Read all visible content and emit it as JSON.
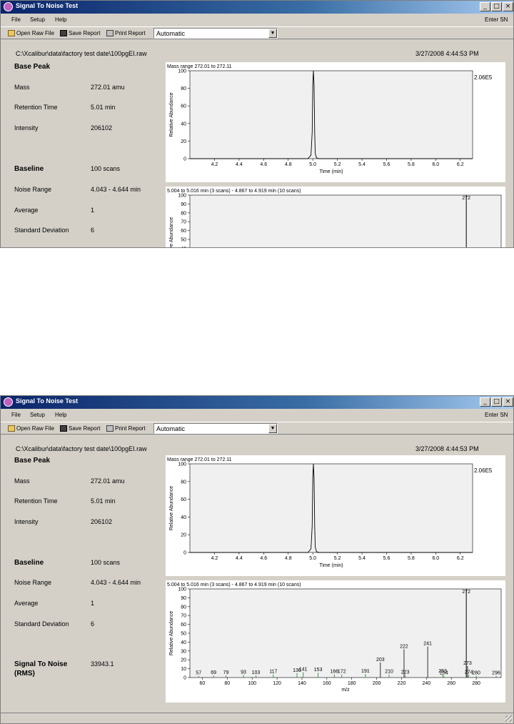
{
  "window": {
    "title": "Signal To Noise Test",
    "minimize_glyph": "_",
    "maximize_glyph": "□",
    "close_glyph": "×"
  },
  "menu": {
    "file": "File",
    "setup": "Setup",
    "help": "Help",
    "enter_sn": "Enter SN"
  },
  "toolbar": {
    "open_raw_file": "Open Raw File",
    "save_report": "Save Report",
    "print_report": "Print Report",
    "mode_select": "Automatic"
  },
  "file_path": "C:\\Xcalibur\\data\\factory test date\\100pgEI.raw",
  "datetime": "3/27/2008 4:44:53 PM",
  "stats": {
    "base_peak": "Base Peak",
    "mass_label": "Mass",
    "mass_value": "272.01 amu",
    "rt_label": "Retention Time",
    "rt_value": "5.01 min",
    "intensity_label": "Intensity",
    "intensity_value": "206102",
    "baseline_label": "Baseline",
    "baseline_value": "100 scans",
    "noise_range_label": "Noise Range",
    "noise_range_value": "4.043 - 4.644 min",
    "average_label": "Average",
    "average_value": "1",
    "std_dev_label": "Standard Deviation",
    "std_dev_value": "6",
    "sn_label_1": "Signal To Noise",
    "sn_label_2": "(RMS)",
    "sn_value": "33943.1"
  },
  "chart_data": [
    {
      "type": "line",
      "title": "Mass range 272.01 to 272.11",
      "xlabel": "Time (min)",
      "ylabel": "Relative Abundance",
      "annotation": "2.06E5",
      "xlim": [
        4.0,
        6.3
      ],
      "ylim": [
        0,
        100
      ],
      "xticks": [
        4.2,
        4.4,
        4.6,
        4.8,
        5.0,
        5.2,
        5.4,
        5.6,
        5.8,
        6.0,
        6.2
      ],
      "yticks": [
        0,
        20,
        40,
        60,
        80,
        100
      ],
      "x": [
        4.0,
        4.96,
        4.985,
        4.995,
        5.0,
        5.005,
        5.01,
        5.015,
        5.02,
        5.03,
        5.05,
        6.3
      ],
      "y": [
        0,
        0,
        4,
        30,
        85,
        100,
        85,
        30,
        6,
        1,
        0,
        0
      ]
    },
    {
      "type": "bar",
      "title": "5.004 to 5.016 min (3 scans) - 4.867 to 4.919 min (10 scans)",
      "xlabel": "m/z",
      "ylabel": "Relative Abundance",
      "xlim": [
        50,
        300
      ],
      "ylim": [
        0,
        100
      ],
      "xticks": [
        60,
        80,
        100,
        120,
        140,
        160,
        180,
        200,
        220,
        240,
        260,
        280
      ],
      "yticks": [
        0,
        10,
        20,
        30,
        40,
        50,
        60,
        70,
        80,
        90,
        100
      ],
      "peaks": [
        {
          "mz": 57,
          "value": 2,
          "label": "57"
        },
        {
          "mz": 69,
          "value": 2.5,
          "label": "69"
        },
        {
          "mz": 79,
          "value": 2.5,
          "label": "79"
        },
        {
          "mz": 93,
          "value": 3,
          "label": "93"
        },
        {
          "mz": 103,
          "value": 2.5,
          "label": "103"
        },
        {
          "mz": 117,
          "value": 3.5,
          "label": "117"
        },
        {
          "mz": 136,
          "value": 5,
          "label": "136"
        },
        {
          "mz": 141,
          "value": 6,
          "label": "141"
        },
        {
          "mz": 153,
          "value": 5.5,
          "label": "153"
        },
        {
          "mz": 166,
          "value": 3.5,
          "label": "166"
        },
        {
          "mz": 172,
          "value": 3.5,
          "label": "172"
        },
        {
          "mz": 191,
          "value": 4,
          "label": "191"
        },
        {
          "mz": 203,
          "value": 17,
          "label": "203"
        },
        {
          "mz": 210,
          "value": 3.5,
          "label": "210"
        },
        {
          "mz": 222,
          "value": 32,
          "label": "222"
        },
        {
          "mz": 223,
          "value": 3,
          "label": "223"
        },
        {
          "mz": 241,
          "value": 35,
          "label": "241"
        },
        {
          "mz": 253,
          "value": 4,
          "label": "253"
        },
        {
          "mz": 254,
          "value": 2,
          "label": "254"
        },
        {
          "mz": 272,
          "value": 100,
          "label": "272"
        },
        {
          "mz": 273,
          "value": 13,
          "label": "273"
        },
        {
          "mz": 274,
          "value": 3,
          "label": "274"
        },
        {
          "mz": 280,
          "value": 2,
          "label": "280"
        },
        {
          "mz": 296,
          "value": 2,
          "label": "296"
        }
      ]
    }
  ],
  "colors": {
    "window_bg": "#d4d0c8",
    "titlebar": "#0a246a",
    "plot_area": "#f0f0f0",
    "trace": "#000000",
    "small_peaks": "#208020"
  }
}
